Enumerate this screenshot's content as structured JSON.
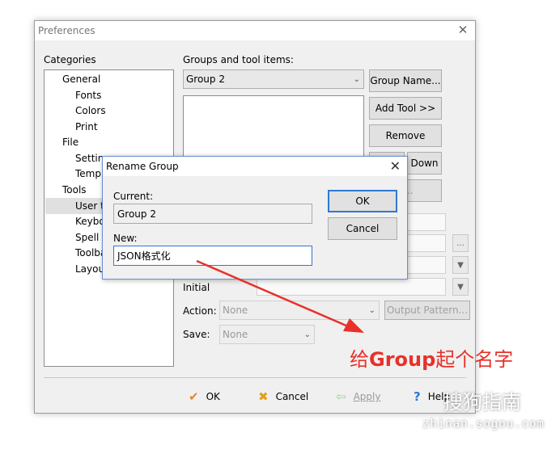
{
  "window": {
    "title": "Preferences",
    "close_glyph": "✕"
  },
  "categories": {
    "label": "Categories",
    "items": [
      "General",
      "Fonts",
      "Colors",
      "Print",
      "File",
      "Setting",
      "Templ",
      "Tools",
      "User t",
      "Keybo",
      "Spell c",
      "Toolba",
      "Layout"
    ]
  },
  "groups": {
    "label": "Groups and tool items:",
    "selected": "Group 2",
    "buttons": {
      "group_name": "Group Name...",
      "add_tool": "Add Tool >>",
      "remove": "Remove",
      "down": "Down",
      "hidden_partial": "n..."
    },
    "initial_label": "Initial",
    "action_label": "Action:",
    "action_value": "None",
    "output_pattern": "Output Pattern...",
    "save_label": "Save:",
    "save_value": "None",
    "ellipsis": "..."
  },
  "bottom": {
    "ok": "OK",
    "cancel": "Cancel",
    "apply": "Apply",
    "help": "Help"
  },
  "rename_dialog": {
    "title": "Rename Group",
    "current_label": "Current:",
    "current_value": "Group 2",
    "new_label": "New:",
    "new_value": "JSON格式化",
    "ok": "OK",
    "cancel": "Cancel"
  },
  "annotation": {
    "prefix": "给",
    "bold": "Group",
    "suffix": "起个名字",
    "color": "#e8312a"
  },
  "watermark": {
    "text": "搜狗指南",
    "url": "zhinan.sogou.com"
  },
  "colors": {
    "accent": "#2f78d4",
    "annotation": "#e8312a"
  }
}
